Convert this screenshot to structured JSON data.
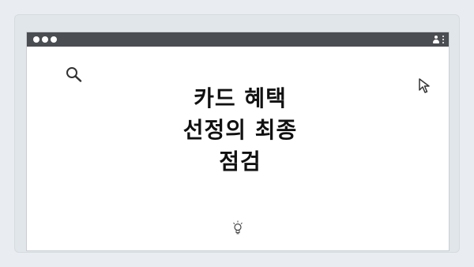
{
  "page_indicator": "○ ○ ○ ○",
  "window": {
    "titlebar": {
      "dots_count": 3
    }
  },
  "content": {
    "headline_line1": "카드 혜택",
    "headline_line2": "선정의 최종",
    "headline_line3": "점검"
  },
  "icons": {
    "search": "search-icon",
    "cursor": "cursor-icon",
    "lightbulb": "lightbulb-icon",
    "account": "person-icon",
    "menu": "kebab-menu-icon"
  },
  "colors": {
    "background": "#e9edf1",
    "titlebar": "#4a4d51",
    "window": "#ffffff",
    "text": "#111111"
  }
}
